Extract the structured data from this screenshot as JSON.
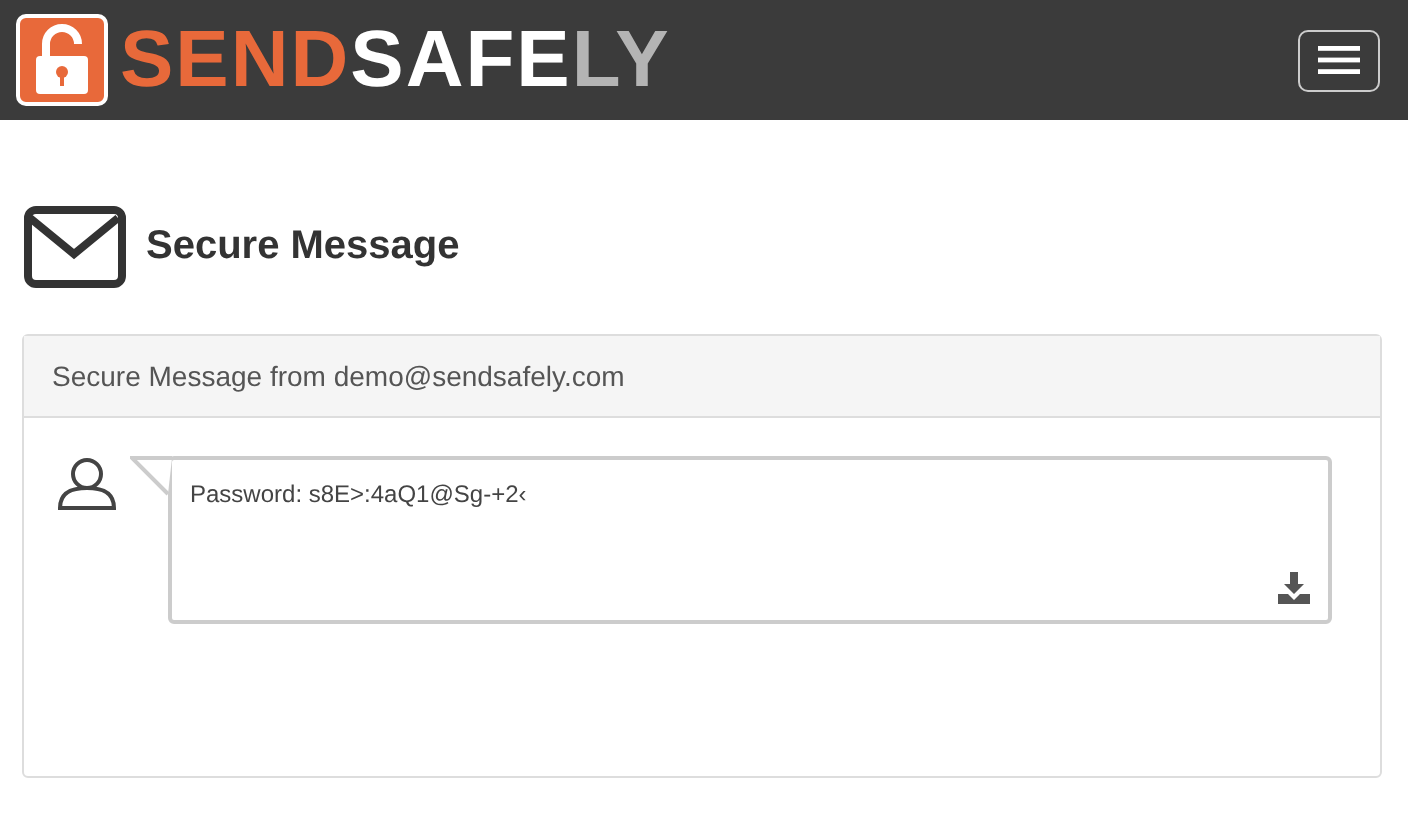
{
  "navbar": {
    "logo_parts": [
      {
        "text": "SEND",
        "color": "#e8693a"
      },
      {
        "text": "SAFE",
        "color": "#ffffff"
      },
      {
        "text": "LY",
        "color": "#b4b4b4"
      }
    ]
  },
  "page": {
    "title": "Secure Message"
  },
  "panel": {
    "heading": "Secure Message from demo@sendsafely.com",
    "message": "Password: s8E>:4aQ1@Sg-+2‹"
  }
}
